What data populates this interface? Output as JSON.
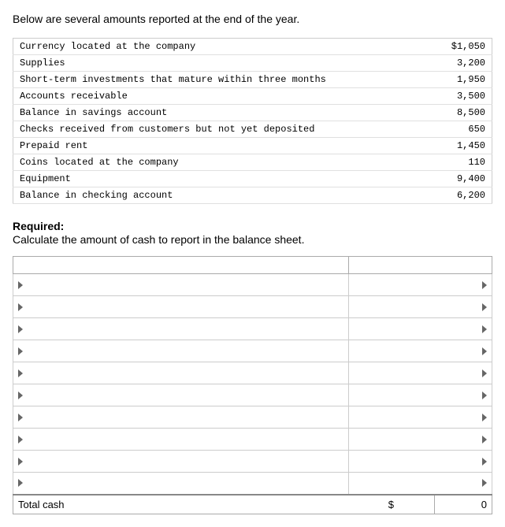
{
  "intro": {
    "text": "Below are several amounts reported at the end of the year."
  },
  "data_items": [
    {
      "label": "Currency located at the company",
      "value": "$1,050"
    },
    {
      "label": "Supplies",
      "value": "3,200"
    },
    {
      "label": "Short-term investments that mature within three months",
      "value": "1,950"
    },
    {
      "label": "Accounts receivable",
      "value": "3,500"
    },
    {
      "label": "Balance in savings account",
      "value": "8,500"
    },
    {
      "label": "Checks received from customers but not yet deposited",
      "value": "650"
    },
    {
      "label": "Prepaid rent",
      "value": "1,450"
    },
    {
      "label": "Coins located at the company",
      "value": "110"
    },
    {
      "label": "Equipment",
      "value": "9,400"
    },
    {
      "label": "Balance in checking account",
      "value": "6,200"
    }
  ],
  "required": {
    "label": "Required:",
    "description": "Calculate the amount of cash to report in the balance sheet."
  },
  "answer_table": {
    "rows": [
      {
        "label": "",
        "value": ""
      },
      {
        "label": "",
        "value": ""
      },
      {
        "label": "",
        "value": ""
      },
      {
        "label": "",
        "value": ""
      },
      {
        "label": "",
        "value": ""
      },
      {
        "label": "",
        "value": ""
      },
      {
        "label": "",
        "value": ""
      },
      {
        "label": "",
        "value": ""
      },
      {
        "label": "",
        "value": ""
      },
      {
        "label": "",
        "value": ""
      }
    ],
    "total_label": "Total cash",
    "total_dollar": "$",
    "total_value": "0"
  }
}
